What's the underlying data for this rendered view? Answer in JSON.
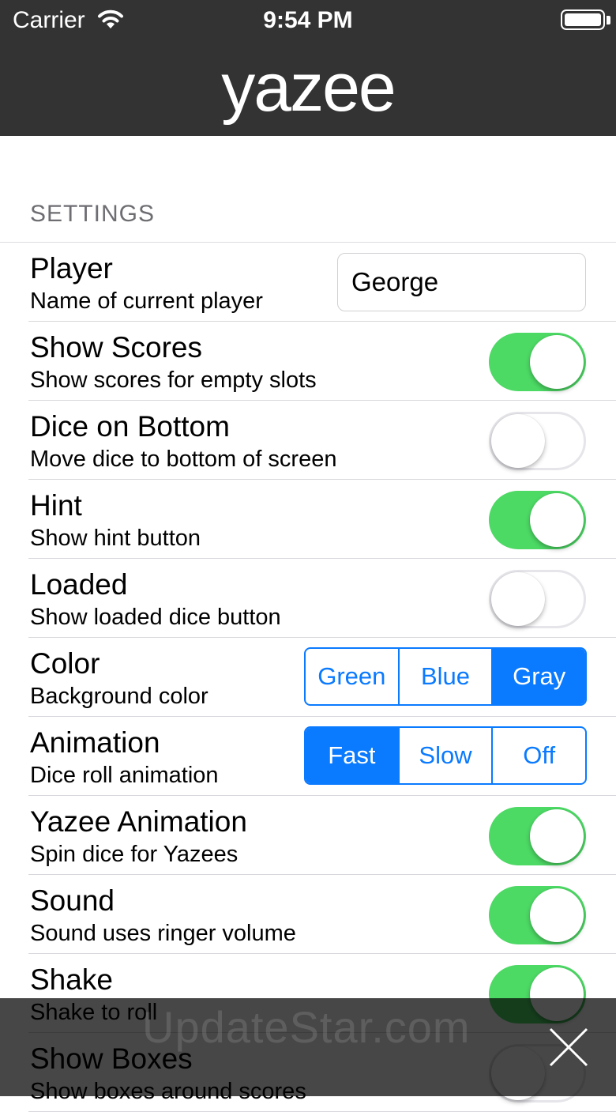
{
  "status_bar": {
    "carrier": "Carrier",
    "time": "9:54 PM"
  },
  "app": {
    "title": "yazee"
  },
  "section": {
    "header": "SETTINGS"
  },
  "rows": [
    {
      "title": "Player",
      "subtitle": "Name of current player",
      "control": "text",
      "value": "George"
    },
    {
      "title": "Show Scores",
      "subtitle": "Show scores for empty slots",
      "control": "switch",
      "on": true
    },
    {
      "title": "Dice on Bottom",
      "subtitle": "Move dice to bottom of screen",
      "control": "switch",
      "on": false
    },
    {
      "title": "Hint",
      "subtitle": "Show hint button",
      "control": "switch",
      "on": true
    },
    {
      "title": "Loaded",
      "subtitle": "Show loaded dice button",
      "control": "switch",
      "on": false
    },
    {
      "title": "Color",
      "subtitle": "Background color",
      "control": "segmented",
      "options": [
        "Green",
        "Blue",
        "Gray"
      ],
      "selected": 2
    },
    {
      "title": "Animation",
      "subtitle": "Dice roll animation",
      "control": "segmented",
      "options": [
        "Fast",
        "Slow",
        "Off"
      ],
      "selected": 0
    },
    {
      "title": "Yazee Animation",
      "subtitle": "Spin dice for Yazees",
      "control": "switch",
      "on": true
    },
    {
      "title": "Sound",
      "subtitle": "Sound uses ringer volume",
      "control": "switch",
      "on": true
    },
    {
      "title": "Shake",
      "subtitle": "Shake to roll",
      "control": "switch",
      "on": true
    },
    {
      "title": "Show Boxes",
      "subtitle": "Show boxes around scores",
      "control": "switch",
      "on": false
    }
  ],
  "overlay": {
    "watermark": "UpdateStar.com"
  },
  "colors": {
    "bar": "#333333",
    "accent": "#0a7aff",
    "switch_on": "#4cd964"
  },
  "icons": {
    "wifi": "wifi-icon",
    "battery": "battery-icon",
    "close": "close-icon"
  }
}
